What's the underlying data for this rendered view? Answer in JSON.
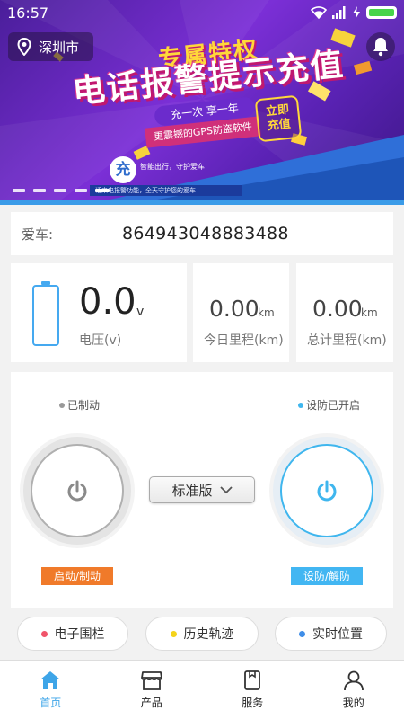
{
  "status_bar": {
    "time": "16:57"
  },
  "location": {
    "city": "深圳市"
  },
  "banner": {
    "title_line1": "专属特权",
    "title_line2": "电话报警提示充值",
    "slogan": "充一次 享一年",
    "sub_slogan": "更震撼的GPS防盗软件",
    "cta_line1": "立即",
    "cta_line2": "充值",
    "logo_char": "充",
    "tagline": "智能出行，守护爱车",
    "strip_text": "话来电报警功能，全天守护您的爱车",
    "pager_count": 5,
    "pager_active": 4
  },
  "vehicle": {
    "label": "爱车:",
    "id": "864943048883488"
  },
  "stats": {
    "voltage": {
      "value": "0.0",
      "unit": "v",
      "label": "电压(v)"
    },
    "today": {
      "value": "0.00",
      "unit": "km",
      "label": "今日里程(km)"
    },
    "total": {
      "value": "0.00",
      "unit": "km",
      "label": "总计里程(km)"
    }
  },
  "control": {
    "engine_status": "已制动",
    "alarm_status": "设防已开启",
    "engine_button": "启动/制动",
    "alarm_button": "设防/解防",
    "version_select": "标准版"
  },
  "quick_actions": [
    {
      "label": "电子围栏",
      "color": "#f0546a"
    },
    {
      "label": "历史轨迹",
      "color": "#f4d31a"
    },
    {
      "label": "实时位置",
      "color": "#3f8ee8"
    }
  ],
  "tabs": [
    {
      "label": "首页",
      "icon": "home-icon",
      "active": true
    },
    {
      "label": "产品",
      "icon": "store-icon",
      "active": false
    },
    {
      "label": "服务",
      "icon": "bookmark-icon",
      "active": false
    },
    {
      "label": "我的",
      "icon": "person-icon",
      "active": false
    }
  ],
  "colors": {
    "accent": "#3ea5e8",
    "engine_button": "#f07a2a",
    "alarm_button": "#42b6f2",
    "battery_fill": "#47d44a"
  }
}
